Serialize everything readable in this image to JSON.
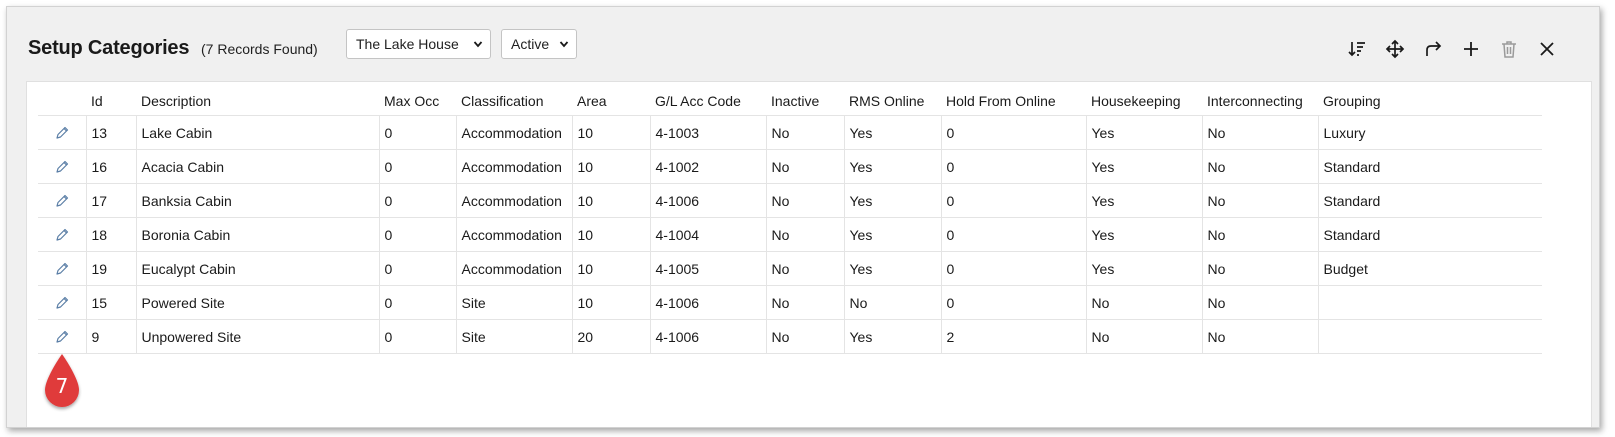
{
  "header": {
    "title": "Setup Categories",
    "record_count": "(7 Records Found)",
    "property_select": "The Lake House",
    "status_select": "Active"
  },
  "toolbar": {
    "icons": [
      "sort-icon",
      "move-icon",
      "redo-arrow-icon",
      "add-icon",
      "delete-icon",
      "close-icon"
    ]
  },
  "table": {
    "columns": [
      "Id",
      "Description",
      "Max Occ",
      "Classification",
      "Area",
      "G/L Acc Code",
      "Inactive",
      "RMS Online",
      "Hold From Online",
      "Housekeeping",
      "Interconnecting",
      "Grouping"
    ],
    "rows": [
      {
        "id": "13",
        "description": "Lake Cabin",
        "max_occ": "0",
        "classification": "Accommodation",
        "area": "10",
        "gl_code": "4-1003",
        "inactive": "No",
        "rms_online": "Yes",
        "hold_from_online": "0",
        "housekeeping": "Yes",
        "interconnecting": "No",
        "grouping": "Luxury"
      },
      {
        "id": "16",
        "description": "Acacia Cabin",
        "max_occ": "0",
        "classification": "Accommodation",
        "area": "10",
        "gl_code": "4-1002",
        "inactive": "No",
        "rms_online": "Yes",
        "hold_from_online": "0",
        "housekeeping": "Yes",
        "interconnecting": "No",
        "grouping": "Standard"
      },
      {
        "id": "17",
        "description": "Banksia Cabin",
        "max_occ": "0",
        "classification": "Accommodation",
        "area": "10",
        "gl_code": "4-1006",
        "inactive": "No",
        "rms_online": "Yes",
        "hold_from_online": "0",
        "housekeeping": "Yes",
        "interconnecting": "No",
        "grouping": "Standard"
      },
      {
        "id": "18",
        "description": "Boronia Cabin",
        "max_occ": "0",
        "classification": "Accommodation",
        "area": "10",
        "gl_code": "4-1004",
        "inactive": "No",
        "rms_online": "Yes",
        "hold_from_online": "0",
        "housekeeping": "Yes",
        "interconnecting": "No",
        "grouping": "Standard"
      },
      {
        "id": "19",
        "description": "Eucalypt Cabin",
        "max_occ": "0",
        "classification": "Accommodation",
        "area": "10",
        "gl_code": "4-1005",
        "inactive": "No",
        "rms_online": "Yes",
        "hold_from_online": "0",
        "housekeeping": "Yes",
        "interconnecting": "No",
        "grouping": "Budget"
      },
      {
        "id": "15",
        "description": "Powered Site",
        "max_occ": "0",
        "classification": "Site",
        "area": "10",
        "gl_code": "4-1006",
        "inactive": "No",
        "rms_online": "No",
        "hold_from_online": "0",
        "housekeeping": "No",
        "interconnecting": "No",
        "grouping": ""
      },
      {
        "id": "9",
        "description": "Unpowered Site",
        "max_occ": "0",
        "classification": "Site",
        "area": "20",
        "gl_code": "4-1006",
        "inactive": "No",
        "rms_online": "Yes",
        "hold_from_online": "2",
        "housekeeping": "No",
        "interconnecting": "No",
        "grouping": ""
      }
    ]
  },
  "callout": {
    "label": "7",
    "color": "#e03a3a"
  },
  "colors": {
    "edit_icon": "#5a7ea6",
    "toolbar_icon": "#1a1a1a",
    "delete_icon_disabled": "#9a9a9a"
  }
}
